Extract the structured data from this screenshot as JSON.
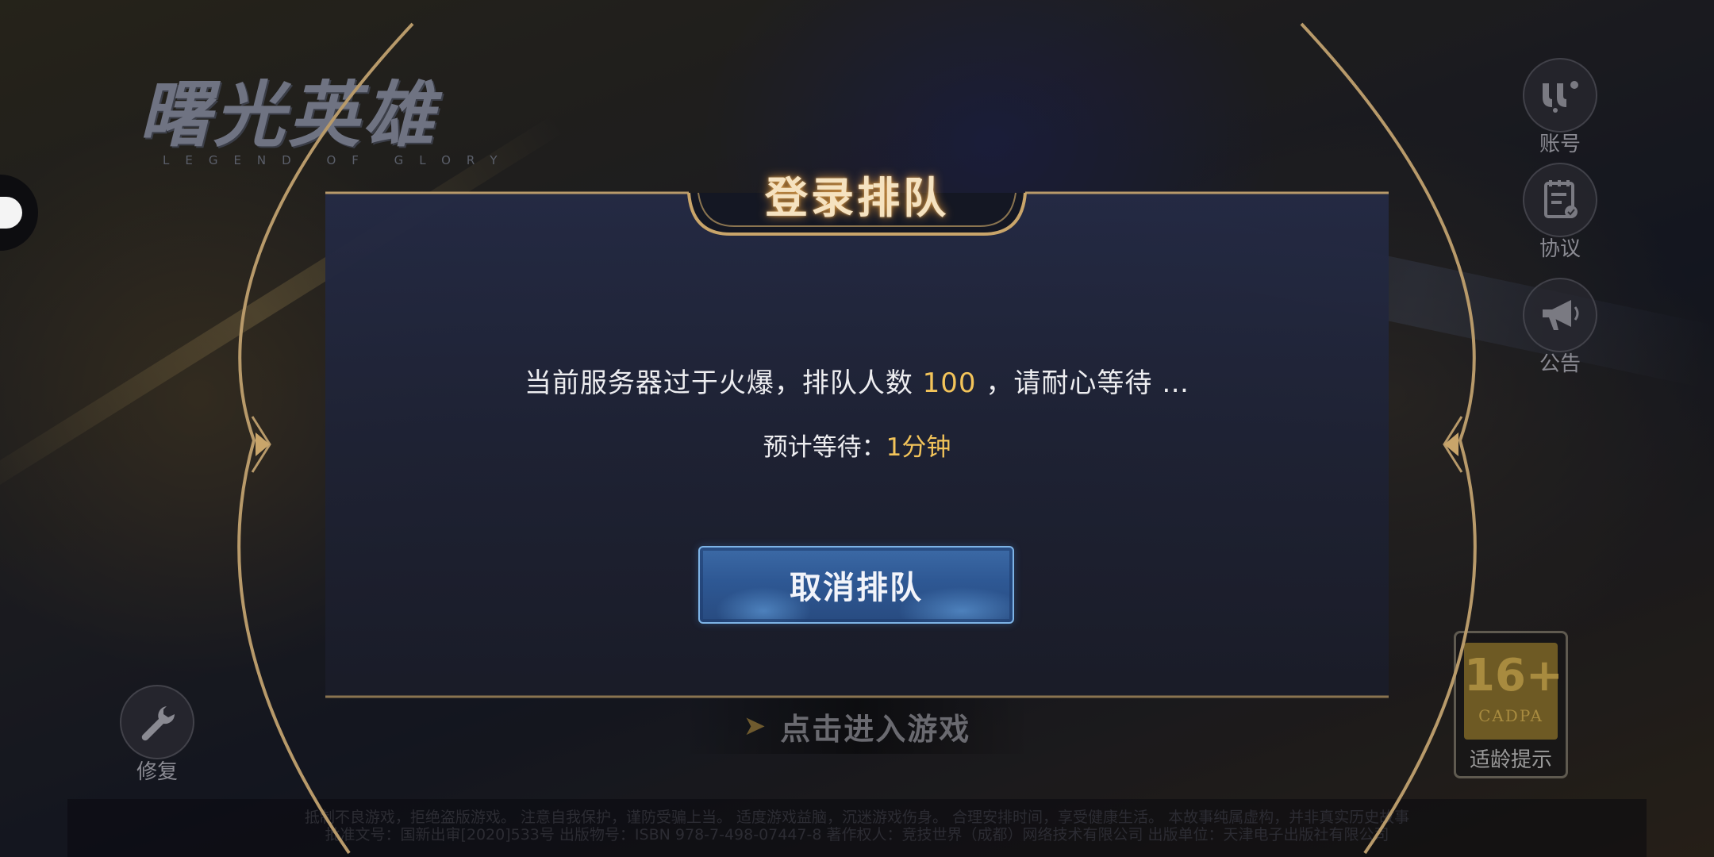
{
  "logo": {
    "title": "曙光英雄",
    "subtitle": "LEGEND OF GLORY"
  },
  "right_menu": [
    {
      "label": "账号",
      "icon": "account-icon"
    },
    {
      "label": "协议",
      "icon": "agreement-icon"
    },
    {
      "label": "公告",
      "icon": "announcement-icon"
    }
  ],
  "repair": {
    "label": "修复",
    "icon": "wrench-icon"
  },
  "age_rating": {
    "number": "16+",
    "code": "CADPA",
    "label": "适龄提示"
  },
  "enter_game": {
    "label": "点击进入游戏"
  },
  "dialog": {
    "title": "登录排队",
    "message_prefix": "当前服务器过于火爆，排队人数 ",
    "queue_count": "100",
    "message_suffix": " ，请耐心等待 …",
    "wait_label": "预计等待：",
    "wait_time": "1分钟",
    "cancel_label": "取消排队"
  },
  "footer": {
    "line1": "抵制不良游戏，拒绝盗版游戏。 注意自我保护，谨防受骗上当。 适度游戏益脑，沉迷游戏伤身。 合理安排时间，享受健康生活。 本故事纯属虚构，并非真实历史故事",
    "line2": "批准文号：国新出审[2020]533号 出版物号：ISBN 978-7-498-07447-8 著作权人：竞技世界（成都）网络技术有限公司 出版单位：天津电子出版社有限公司"
  },
  "colors": {
    "accent_gold": "#f3c45a",
    "frame_gold": "#b89a6a",
    "button_blue": "#2e5894"
  }
}
